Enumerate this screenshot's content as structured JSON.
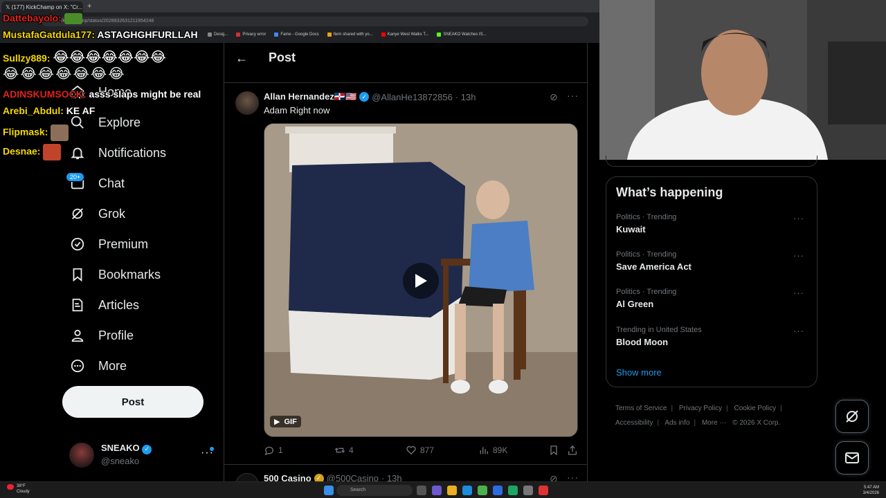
{
  "browser": {
    "tab_title": "(177) KickChamp on X: \"Cr...",
    "new_tab": "+",
    "address": "x.com/KickChamp/status/2028932631211954246",
    "bookmarks": [
      "Desig...",
      "Privacy error",
      "Fame - Google Docs",
      "Item shared with yo...",
      "Kanye West Walks T...",
      "SNEAKO Watches IS..."
    ]
  },
  "stream_chat": [
    {
      "user": "Dattebayolo:",
      "color": "#e2231a",
      "message": ""
    },
    {
      "user": "MustafaGatdula177:",
      "color": "#f5d800",
      "message": "ASTAGHGHFURLLAH"
    },
    {
      "user": "Sullzy889:",
      "color": "#f5d800",
      "message": "😂😂😂😂😂😂😂"
    },
    {
      "user": "",
      "color": "#f5d800",
      "message": "😂😂😂😂😂😂😂"
    },
    {
      "user": "ADINSKUMSOCK:",
      "color": "#e2231a",
      "message": "asss slaps might be real"
    },
    {
      "user": "Arebi_Abdul:",
      "color": "#f5d800",
      "message": "KE AF"
    },
    {
      "user": "Flipmask:",
      "color": "#f5d800",
      "message": ""
    },
    {
      "user": "Desnae:",
      "color": "#f5d800",
      "message": ""
    }
  ],
  "nav": {
    "items": [
      {
        "label": "Home",
        "icon": "home-icon"
      },
      {
        "label": "Explore",
        "icon": "search-icon"
      },
      {
        "label": "Notifications",
        "icon": "bell-icon"
      },
      {
        "label": "Chat",
        "icon": "chat-icon"
      },
      {
        "label": "Grok",
        "icon": "grok-icon"
      },
      {
        "label": "Premium",
        "icon": "premium-icon"
      },
      {
        "label": "Bookmarks",
        "icon": "bookmark-icon"
      },
      {
        "label": "Articles",
        "icon": "articles-icon"
      },
      {
        "label": "Profile",
        "icon": "profile-icon"
      },
      {
        "label": "More",
        "icon": "more-circle-icon"
      }
    ],
    "chat_badge": "20+",
    "post_label": "Post"
  },
  "account": {
    "name": "SNEAKO",
    "handle": "@sneako"
  },
  "center": {
    "header_title": "Post",
    "tweet": {
      "name": "Allan Hernandez🇩🇴🇺🇸",
      "handle": "@AllanHe13872856",
      "time": "· 13h",
      "text": "Adam Right now",
      "gif_label": "GIF",
      "replies": "1",
      "reposts": "4",
      "likes": "877",
      "views": "89K"
    },
    "tweet2": {
      "avatar_text": "500",
      "name": "500 Casino",
      "handle": "@500Casino",
      "time": "· 13h"
    }
  },
  "trends": {
    "title": "What’s happening",
    "items": [
      {
        "category": "Politics · Trending",
        "name": "Kuwait"
      },
      {
        "category": "Politics · Trending",
        "name": "Save America Act"
      },
      {
        "category": "Politics · Trending",
        "name": "Al Green"
      },
      {
        "category": "Trending in United States",
        "name": "Blood Moon"
      }
    ],
    "show_more": "Show more"
  },
  "footer": {
    "links": [
      "Terms of Service",
      "Privacy Policy",
      "Cookie Policy",
      "Accessibility",
      "Ads info",
      "More ···"
    ],
    "copyright": "© 2026 X Corp."
  },
  "taskbar": {
    "temp": "38°F",
    "condition": "Cloudy",
    "search_placeholder": "Search",
    "time": "5:47 AM",
    "date": "3/4/2026"
  },
  "colors": {
    "accent": "#1d9bf0",
    "background": "#000000",
    "muted": "#71767b",
    "border": "#2f3336"
  }
}
